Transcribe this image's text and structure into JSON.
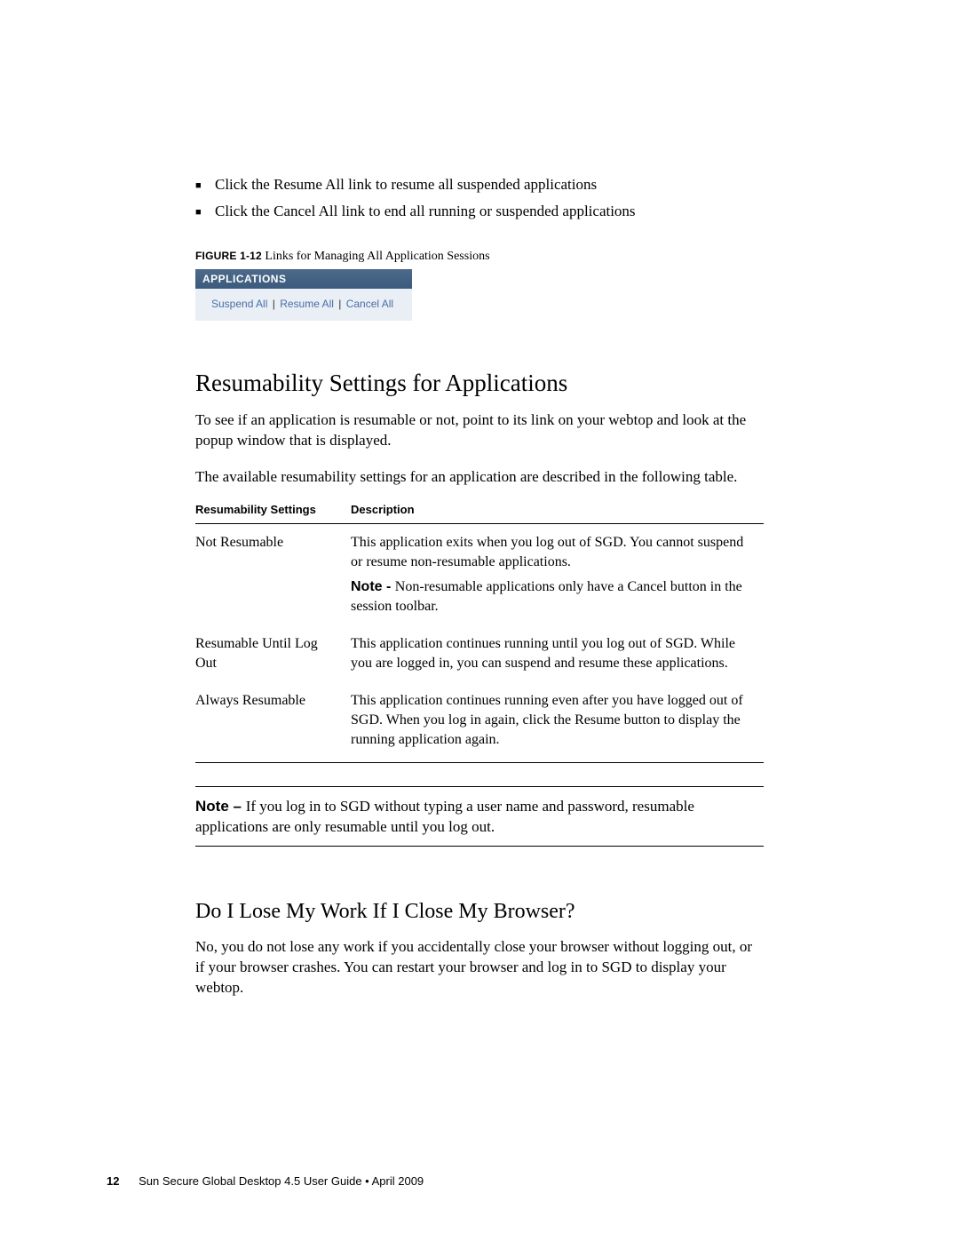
{
  "bullets": [
    "Click the Resume All link to resume all suspended applications",
    "Click the Cancel All link to end all running or suspended applications"
  ],
  "figure": {
    "label": "FIGURE 1-12",
    "caption": "Links for Managing All Application Sessions"
  },
  "applet": {
    "header": "APPLICATIONS",
    "links": {
      "suspend": "Suspend All",
      "resume": "Resume All",
      "cancel": "Cancel All"
    }
  },
  "section1": {
    "heading": "Resumability Settings for Applications",
    "p1": "To see if an application is resumable or not, point to its link on your webtop and look at the popup window that is displayed.",
    "p2": "The available resumability settings for an application are described in the following table."
  },
  "table": {
    "headers": {
      "c1": "Resumability Settings",
      "c2": "Description"
    },
    "rows": [
      {
        "c1": "Not Resumable",
        "c2_main": "This application exits when you log out of SGD. You cannot suspend or resume non-resumable applications.",
        "c2_note_label": "Note - ",
        "c2_note": "Non-resumable applications only have a Cancel button in the session toolbar."
      },
      {
        "c1": "Resumable Until Log Out",
        "c2_main": "This application continues running until you log out of SGD. While you are logged in, you can suspend and resume these applications."
      },
      {
        "c1": "Always Resumable",
        "c2_main": "This application continues running even after you have logged out of SGD. When you log in again, click the Resume button to display the running application again."
      }
    ]
  },
  "note": {
    "label": "Note – ",
    "text": "If you log in to SGD without typing a user name and password, resumable applications are only resumable until you log out."
  },
  "section2": {
    "heading": "Do I Lose My Work If I Close My Browser?",
    "p1": "No, you do not lose any work if you accidentally close your browser without logging out, or if your browser crashes. You can restart your browser and log in to SGD to display your webtop."
  },
  "footer": {
    "page": "12",
    "text": "Sun Secure Global Desktop 4.5 User Guide • April 2009"
  }
}
